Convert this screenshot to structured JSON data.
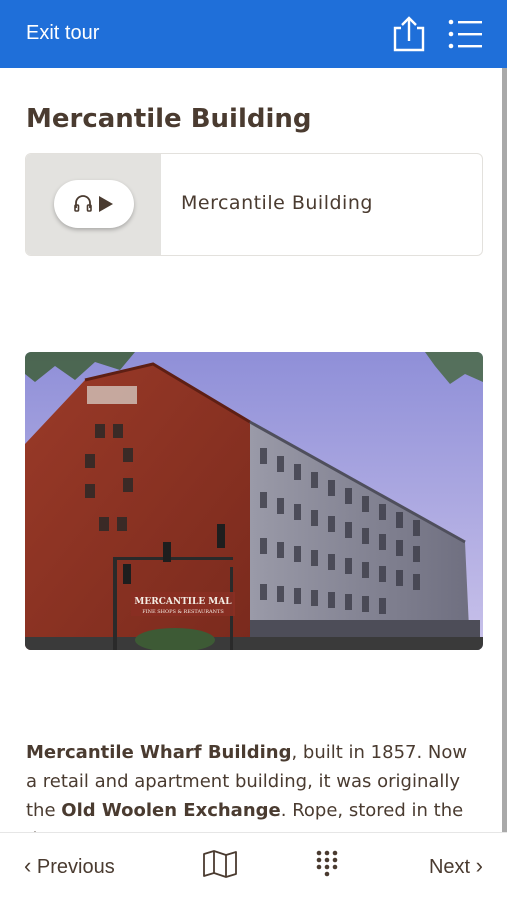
{
  "header": {
    "exit_label": "Exit tour",
    "share_icon": "share-icon",
    "menu_icon": "list-icon"
  },
  "stop": {
    "title": "Mercantile Building",
    "audio_title": "Mercantile Building",
    "photo_sign_line1": "MERCANTILE MAL",
    "photo_sign_line2": "FINE SHOPS & RESTAURANTS"
  },
  "description": {
    "part1_bold": "Mercantile Wharf Building",
    "part2": ", built in 1857. Now a retail and apartment building, it was originally the ",
    "part3_bold": "Old Woolen Exchange",
    "part4": ". Rope, stored in the damp"
  },
  "footer": {
    "previous_label": "Previous",
    "next_label": "Next",
    "map_icon": "map-icon",
    "keypad_icon": "keypad-icon"
  },
  "colors": {
    "header_bg": "#1f6fd9",
    "text": "#4a3b30",
    "audio_thumb_bg": "#e3e2df"
  }
}
